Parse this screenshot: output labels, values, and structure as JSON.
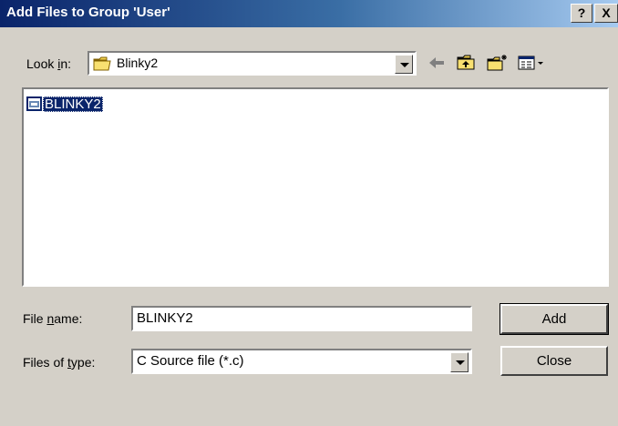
{
  "window": {
    "title": "Add Files to Group 'User'",
    "help_label": "?",
    "close_label": "X"
  },
  "look_in": {
    "label_pre": "Look ",
    "label_accel": "i",
    "label_post": "n:",
    "value": "Blinky2",
    "folder_icon": "folder-icon"
  },
  "toolbar": {
    "back_icon": "back-arrow-icon",
    "up_icon": "up-folder-icon",
    "new_folder_icon": "new-folder-icon",
    "view_icon": "view-menu-icon"
  },
  "files": {
    "items": [
      {
        "name": "BLINKY2",
        "icon": "project-file-icon",
        "selected": true
      }
    ]
  },
  "file_name": {
    "label_pre": "File ",
    "label_accel": "n",
    "label_post": "ame:",
    "value": "BLINKY2"
  },
  "file_type": {
    "label_pre": "Files of ",
    "label_accel": "t",
    "label_post": "ype:",
    "value": "C Source file (*.c)"
  },
  "buttons": {
    "add": "Add",
    "close": "Close"
  },
  "colors": {
    "titlebar_start": "#0a246a",
    "titlebar_end": "#a6caf0",
    "face": "#d4d0c8",
    "selection": "#0a246a",
    "folder": "#f0d050"
  }
}
